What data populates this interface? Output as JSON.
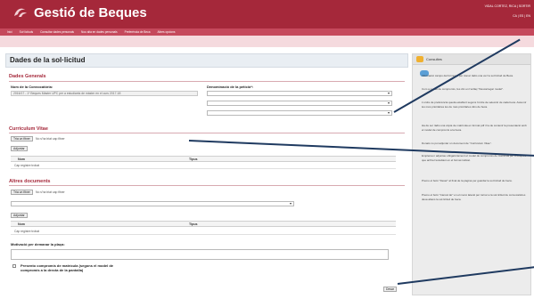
{
  "header": {
    "app_title": "Gestió de Beques",
    "user_line1": "VIDAL CORTEZ, RICA | SORTIR",
    "user_line2": "CA | ES | EN"
  },
  "nav": {
    "items": [
      "Inici",
      "Sol·licituds",
      "Consultar dades personals",
      "Nou alta en dades personals",
      "Preferència de Beca",
      "Altres opcions"
    ]
  },
  "main": {
    "page_title": "Dades de la sol·licitud",
    "general": {
      "title": "Dades Generals",
      "call_label": "Nom de la Convocatòria:",
      "call_value": "2016/17 - 1º Beques Màster UPC per a estudiants de màster en el curs 2017-18",
      "denom_label": "Denominació de la petició*:"
    },
    "cv": {
      "title": "Curriculum Vitae",
      "browse": "Tria un fitxer",
      "no_file": "No s'ha triat cap fitxer",
      "attach": "Adjuntar",
      "col_name": "Nom",
      "col_type": "Tipus",
      "empty": "Cap registre trobat"
    },
    "other_docs": {
      "title": "Altres documents",
      "browse": "Tria un fitxer",
      "no_file": "No s'ha triat cap fitxer",
      "attach": "Adjuntar",
      "col_name": "Nom",
      "col_type": "Tipus",
      "empty": "Cap registre trobat"
    },
    "motivation_label": "Motivació per demanar la plaça:",
    "commitment_label": "Presento compromís de matrícula (segons el model de compromís a la drecta de la pantalla)",
    "save": "Desar"
  },
  "sidebar": {
    "title": "Consultes",
    "tips": [
      "Informació campo del formulari per donar ràdio una vez la sol·licitud de Beca.",
      "Com a model de compromís, fes clic en l'enllaç \"Descarregar model\".",
      "L'ordre de preferència queda establert segons l'ordre de selecció de cada beca. Assumir les més prioritàries les de més prioritàries dins de beca.",
      "Ha de ser ràdio una còpia de matrícula en format pdf i ha de contenir la presentació amb el model de compromís a la beca.",
      "Donats no pot adjuntar un document de \"Curriculum Vitae\".",
      "Emplenau i adjuntau obligatòriament el model de compromís de matrícula per a després que arriba l'estudiant en el format indicat.",
      "Premo el botó \"Desar\" al final de la pàgina per guardar la sol·licitud de beca.",
      "Premo el botó \"Cancel·lar\" en el menú lateral per tornar a la sol·licitud de convocatòries desa abans la sol·licitud de beca."
    ]
  }
}
